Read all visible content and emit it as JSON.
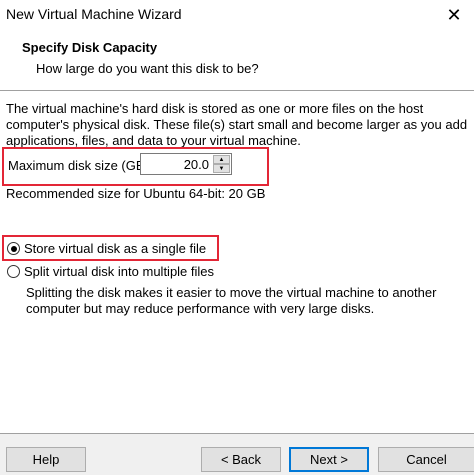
{
  "window": {
    "title": "New Virtual Machine Wizard"
  },
  "header": {
    "title": "Specify Disk Capacity",
    "subtitle": "How large do you want this disk to be?"
  },
  "content": {
    "description": "The virtual machine's hard disk is stored as one or more files on the host computer's physical disk. These file(s) start small and become larger as you add applications, files, and data to your virtual machine.",
    "max_size_label": "Maximum disk size (GB):",
    "max_size_value": "20.0",
    "recommended": "Recommended size for Ubuntu 64-bit: 20 GB",
    "options": [
      {
        "label": "Store virtual disk as a single file",
        "selected": true
      },
      {
        "label": "Split virtual disk into multiple files",
        "selected": false
      }
    ],
    "note": "Splitting the disk makes it easier to move the virtual machine to another computer but may reduce performance with very large disks."
  },
  "footer": {
    "help": "Help",
    "back": "< Back",
    "next": "Next >",
    "cancel": "Cancel"
  },
  "colors": {
    "highlight_box": "#e32636",
    "default_button_border": "#0078d7"
  }
}
